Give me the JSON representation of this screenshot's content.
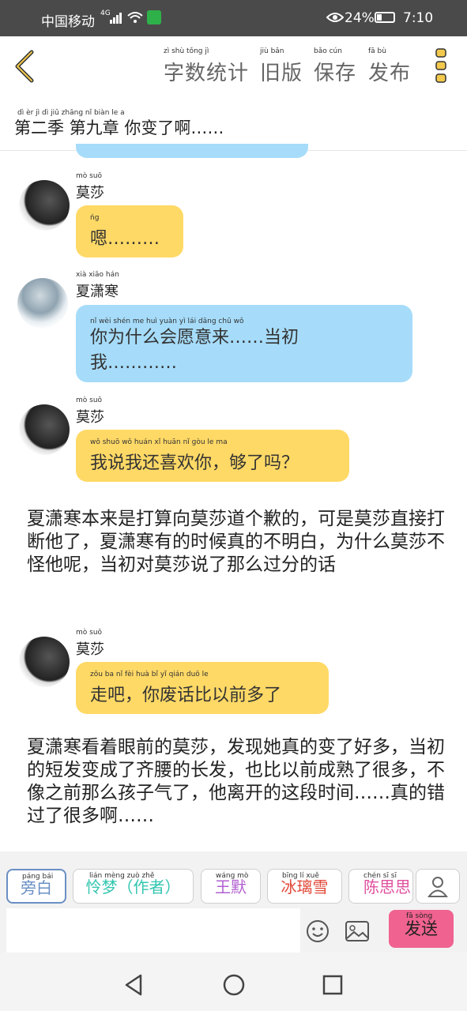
{
  "status_bar": {
    "carrier": "中国移动",
    "network": "4G",
    "battery": "24%",
    "time": "7:10"
  },
  "header": {
    "stats_label": "字数统计",
    "old_version_label": "旧版",
    "save_label": "保存",
    "publish_label": "发布",
    "stats_pinyin": "zì shù tǒng jì",
    "old_version_pinyin": "jiù bǎn",
    "save_pinyin": "bǎo cún",
    "publish_pinyin": "fā bù"
  },
  "chapter": {
    "title": "第二季 第九章 你变了啊……",
    "pinyin": "dì èr jì  dì jiǔ zhāng nǐ biàn le a"
  },
  "messages": [
    {
      "speaker": "莫莎",
      "speaker_pinyin": "mò suō",
      "text": "嗯………",
      "text_pinyin": "ńg"
    },
    {
      "speaker": "夏潇寒",
      "speaker_pinyin": "xià xiāo hán",
      "text": "你为什么会愿意来……当初我…………",
      "text_pinyin": "nǐ wèi shén me huì yuàn yì lái  dāng chū wǒ"
    },
    {
      "speaker": "莫莎",
      "speaker_pinyin": "mò suō",
      "text": "我说我还喜欢你，够了吗？",
      "text_pinyin": "wǒ shuō wǒ huán xǐ huān nǐ gòu le ma"
    },
    {
      "speaker": "莫莎",
      "speaker_pinyin": "mò suō",
      "text": "走吧，你废话比以前多了",
      "text_pinyin": "zǒu ba nǐ fèi huà bǐ yǐ qián duō le"
    }
  ],
  "narration": [
    "夏潇寒本来是打算向莫莎道个歉的，可是莫莎直接打断他了，夏潇寒有的时候真的不明白，为什么莫莎不怪他呢，当初对莫莎说了那么过分的话",
    "夏潇寒看着眼前的莫莎，发现她真的变了好多，当初的短发变成了齐腰的长发，也比以前成熟了很多，不像之前那么孩子气了，他离开的这段时间……真的错过了很多啊……"
  ],
  "roles": [
    {
      "label": "旁白",
      "pinyin": "páng bái",
      "color": "#6a8fc4"
    },
    {
      "label": "怜梦（作者）",
      "pinyin": "lián mèng  zuò zhě",
      "color": "#33c6b0"
    },
    {
      "label": "王默",
      "pinyin": "wáng mò",
      "color": "#b25fd0"
    },
    {
      "label": "冰璃雪",
      "pinyin": "bīng lí xuě",
      "color": "#e24a3b"
    },
    {
      "label": "陈思思",
      "pinyin": "chén sī sī",
      "color": "#e0509e"
    }
  ],
  "composer": {
    "input_value": "",
    "send_label": "发送",
    "send_pinyin": "fā sòng"
  },
  "icons": {
    "back": "chevron-left-icon",
    "menu": "more-vertical-icon",
    "profile": "user-icon",
    "emoji": "emoji-icon",
    "image": "image-icon",
    "nav_back": "triangle-back-icon",
    "nav_home": "circle-home-icon",
    "nav_recent": "square-recent-icon"
  },
  "colors": {
    "accent": "#f0628f",
    "yellow_bubble": "#ffd966",
    "blue_bubble": "#a6dcfa",
    "status_bar": "#4a4a4a"
  }
}
